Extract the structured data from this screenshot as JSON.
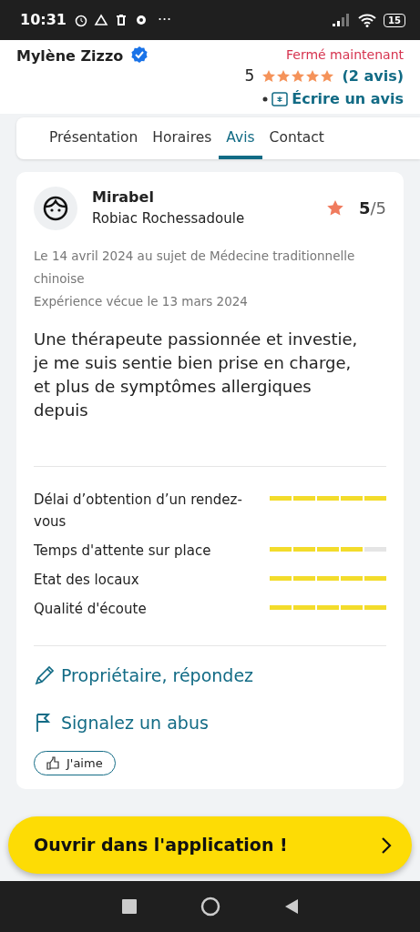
{
  "status_bar": {
    "time": "10:31",
    "more": "···",
    "battery": "15"
  },
  "header": {
    "name": "Mylène Zizzo",
    "verified": true,
    "open_status": "Fermé maintenant",
    "rating": "5",
    "stars": 5,
    "reviews_link": "(2 avis)",
    "write_link": "Écrire un avis"
  },
  "tabs": [
    {
      "label": "Présentation",
      "selected": false
    },
    {
      "label": "Horaires",
      "selected": false
    },
    {
      "label": "Avis",
      "selected": true
    },
    {
      "label": "Contact",
      "selected": false
    }
  ],
  "review": {
    "author": "Mirabel",
    "location": "Robiac Rochessadoule",
    "score": "5",
    "score_max": "/5",
    "date": "Le 14 avril 2024 au sujet de Médecine traditionnelle chinoise",
    "experience": "Expérience vécue le 13 mars 2024",
    "text": "Une thérapeute passionnée et investie, je me suis sentie bien prise en charge, et plus de symptômes allergiques depuis",
    "criteria": [
      {
        "label": "Délai d’obtention d’un rendez-vous",
        "level": 1
      },
      {
        "label": "Temps d'attente sur place",
        "level": 0.8
      },
      {
        "label": "Etat des locaux",
        "level": 1
      },
      {
        "label": "Qualité d'écoute",
        "level": 1
      }
    ],
    "actions": [
      {
        "kind": "reply",
        "label": "Propriétaire, répondez"
      },
      {
        "kind": "report",
        "label": "Signalez un abus"
      }
    ],
    "like": "J'aime"
  },
  "open_app": "Ouvrir dans l'application !"
}
